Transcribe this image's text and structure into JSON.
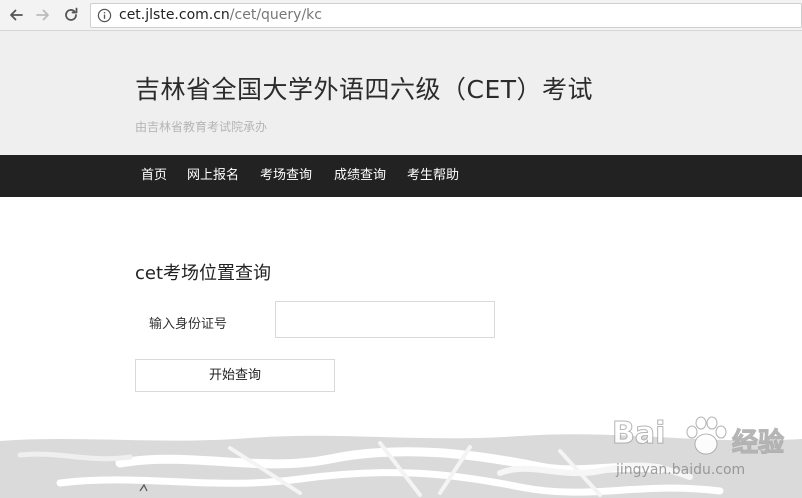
{
  "browser": {
    "url_host": "cet.jlste.com.cn",
    "url_path": "/cet/query/kc",
    "back_icon": "arrow-left-icon",
    "forward_icon": "arrow-right-icon",
    "reload_icon": "reload-icon",
    "info_icon": "info-icon"
  },
  "header": {
    "title": "吉林省全国大学外语四六级（CET）考试",
    "subtitle": "由吉林省教育考试院承办"
  },
  "nav": {
    "items": [
      {
        "label": "首页"
      },
      {
        "label": "网上报名"
      },
      {
        "label": "考场查询"
      },
      {
        "label": "成绩查询"
      },
      {
        "label": "考生帮助"
      }
    ]
  },
  "query": {
    "heading": "cet考场位置查询",
    "id_label": "输入身份证号",
    "id_value": "",
    "id_placeholder": "",
    "submit_label": "开始查询"
  },
  "watermark": {
    "brand": "Bai",
    "brand_end": "经验",
    "domain": "jingyan.baidu.com"
  },
  "colors": {
    "header_bg": "#efefef",
    "nav_bg": "#222222",
    "subtitle": "#b5b5b5"
  }
}
